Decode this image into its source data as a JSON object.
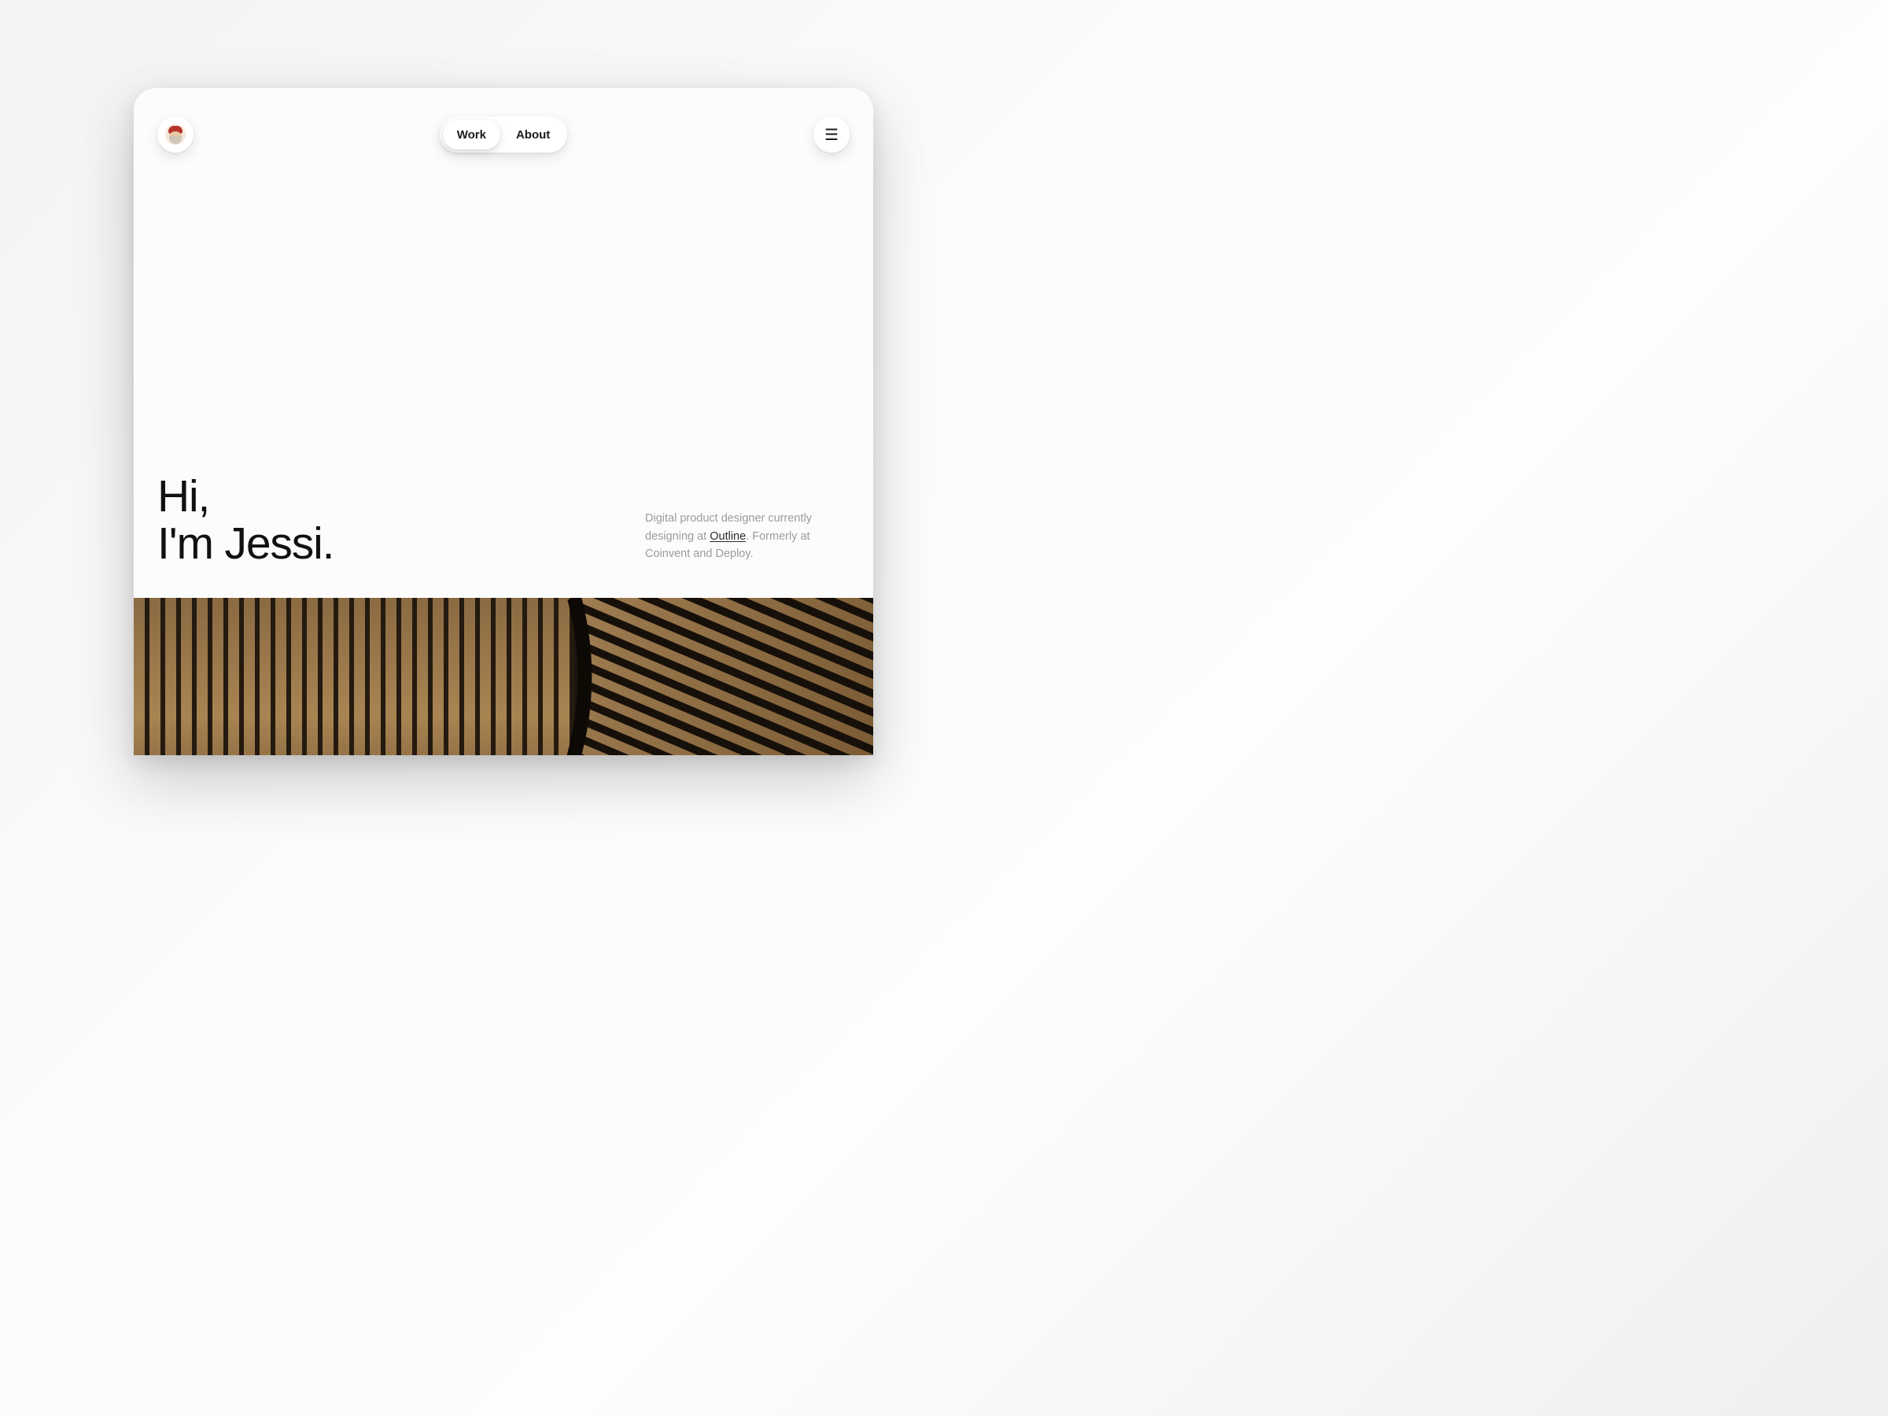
{
  "nav": {
    "items": [
      {
        "label": "Work",
        "active": true
      },
      {
        "label": "About",
        "active": false
      }
    ]
  },
  "avatar": {
    "icon": "avatar-icon"
  },
  "menu": {
    "icon": "hamburger-icon",
    "glyph": "☰"
  },
  "hero": {
    "title_line1": "Hi,",
    "title_line2": "I'm Jessi.",
    "subtitle_pre": "Digital product designer currently designing at ",
    "subtitle_link": "Outline",
    "subtitle_post": ". Formerly at Coinvent and Deploy."
  },
  "colors": {
    "card_bg": "#fcfcfc",
    "text": "#111111",
    "muted": "#9b9b9b",
    "accent": "#b7342a",
    "wood_dark": "#2c2014",
    "wood_light": "#a07a4a"
  }
}
